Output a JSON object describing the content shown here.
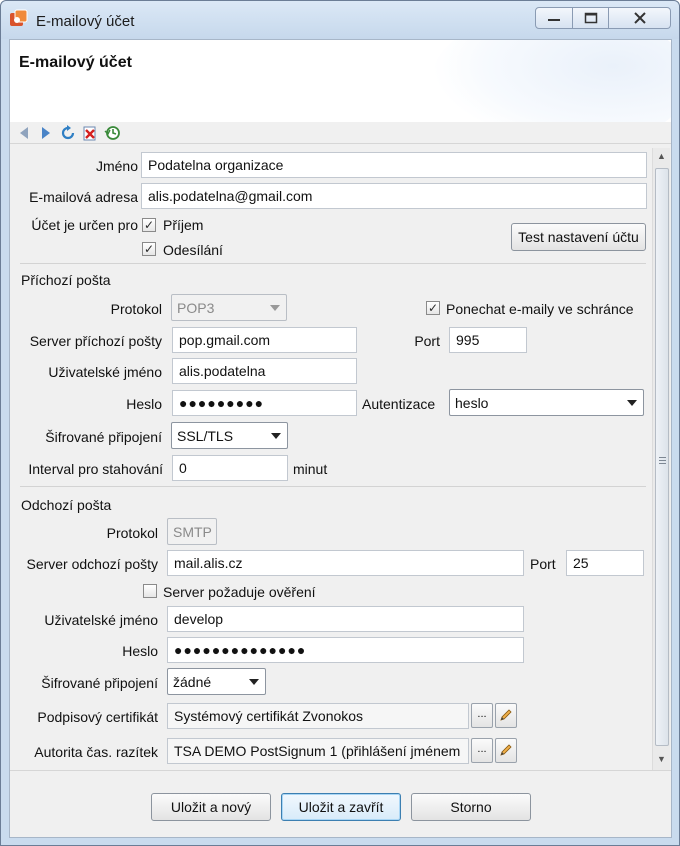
{
  "window": {
    "title": "E-mailový účet"
  },
  "header": {
    "title": "E-mailový účet"
  },
  "general": {
    "name_label": "Jméno",
    "name_value": "Podatelna organizace",
    "email_label": "E-mailová adresa",
    "email_value": "alis.podatelna@gmail.com",
    "purpose_label": "Účet je určen pro",
    "receive_label": "Příjem",
    "send_label": "Odesílání",
    "test_button": "Test nastavení účtu"
  },
  "incoming": {
    "section_title": "Příchozí pošta",
    "protocol_label": "Protokol",
    "protocol_value": "POP3",
    "keep_label": "Ponechat e-maily ve schránce",
    "server_label": "Server příchozí pošty",
    "server_value": "pop.gmail.com",
    "port_label": "Port",
    "port_value": "995",
    "user_label": "Uživatelské jméno",
    "user_value": "alis.podatelna",
    "password_label": "Heslo",
    "password_value": "●●●●●●●●●",
    "auth_label": "Autentizace",
    "auth_value": "heslo",
    "encryption_label": "Šifrované připojení",
    "encryption_value": "SSL/TLS",
    "interval_label": "Interval pro stahování",
    "interval_value": "0",
    "interval_unit": "minut"
  },
  "outgoing": {
    "section_title": "Odchozí pošta",
    "protocol_label": "Protokol",
    "protocol_value": "SMTP",
    "server_label": "Server odchozí pošty",
    "server_value": "mail.alis.cz",
    "port_label": "Port",
    "port_value": "25",
    "auth_required_label": "Server požaduje ověření",
    "user_label": "Uživatelské jméno",
    "user_value": "develop",
    "password_label": "Heslo",
    "password_value": "●●●●●●●●●●●●●●",
    "encryption_label": "Šifrované připojení",
    "encryption_value": "žádné",
    "cert_label": "Podpisový certifikát",
    "cert_value": "Systémový certifikát Zvonokos",
    "tsa_label": "Autorita čas. razítek",
    "tsa_value": "TSA DEMO PostSignum 1 (přihlášení jménem",
    "ellipsis": "..."
  },
  "footer": {
    "save_new": "Uložit a nový",
    "save_close": "Uložit a zavřít",
    "cancel": "Storno"
  },
  "icons": {
    "back": "arrow-left-icon",
    "forward": "arrow-right-icon",
    "refresh": "refresh-icon",
    "delete": "delete-icon",
    "history": "history-icon",
    "edit": "pencil-icon"
  },
  "colors": {
    "accent": "#3c7fb1",
    "title_bar": "#c9dbee",
    "panel": "#f0f0f0"
  }
}
